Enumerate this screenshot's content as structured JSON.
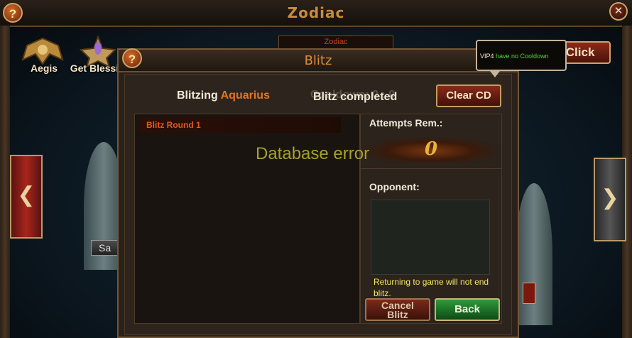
{
  "outer": {
    "title": "Zodiac",
    "help_label": "?",
    "close_label": "✕",
    "aegis_label": "Aegis",
    "blessing_label": "Get Blessi",
    "one_click_label": "1 Click",
    "zodiac_tab_label": "Zodiac",
    "save_label": "Sa",
    "left_arrow": "❮",
    "right_arrow": "❯"
  },
  "dialog": {
    "title": "Blitz",
    "help_label": "?",
    "blitzing_prefix": "Blitzing",
    "blitzing_sign": "Aquarius",
    "cooldown_text": "Cooldown: 0 : 0",
    "completed_text": "Blitz completed",
    "clear_cd_label": "Clear CD",
    "rounds": [
      "Blitz Round 1"
    ],
    "attempts_label": "Attempts Rem.:",
    "attempts_value": "0",
    "opponent_label": "Opponent:",
    "return_note": "Returning to game will not end blitz.",
    "cancel_label_1": "Cancel",
    "cancel_label_2": "Blitz",
    "back_label": "Back",
    "error_text": "Database error"
  },
  "tooltip": {
    "vip": "VIP4",
    "text": " have no Cooldown"
  },
  "colors": {
    "accent_orange": "#e8731e",
    "title_gold": "#d88e3a",
    "error_olive": "#a6a030",
    "note_yellow": "#f3e36a",
    "back_green": "#2f9a3a"
  }
}
